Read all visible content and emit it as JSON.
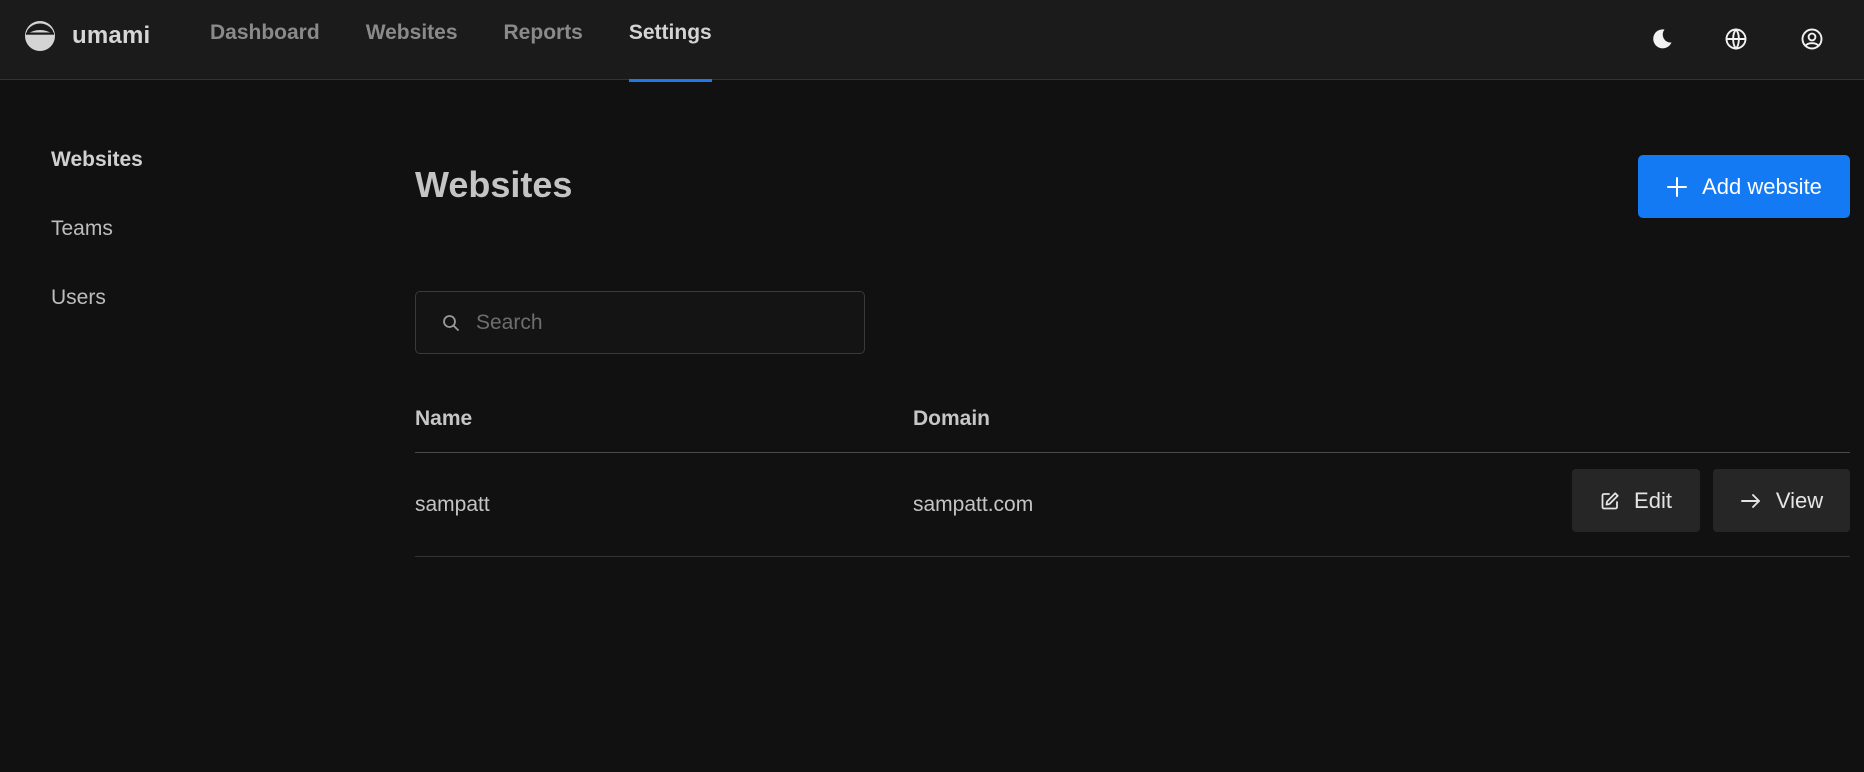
{
  "app": {
    "name": "umami"
  },
  "header": {
    "nav": [
      {
        "label": "Dashboard",
        "active": false
      },
      {
        "label": "Websites",
        "active": false
      },
      {
        "label": "Reports",
        "active": false
      },
      {
        "label": "Settings",
        "active": true
      }
    ],
    "icons": [
      "moon-icon",
      "globe-icon",
      "user-icon"
    ]
  },
  "sidebar": {
    "items": [
      {
        "label": "Websites",
        "active": true
      },
      {
        "label": "Teams",
        "active": false
      },
      {
        "label": "Users",
        "active": false
      }
    ]
  },
  "main": {
    "title": "Websites",
    "add_button": {
      "label": "Add website",
      "icon": "plus-icon"
    },
    "search": {
      "placeholder": "Search",
      "value": ""
    },
    "table": {
      "columns": [
        "Name",
        "Domain"
      ],
      "rows": [
        {
          "name": "sampatt",
          "domain": "sampatt.com",
          "edit_label": "Edit",
          "view_label": "View"
        }
      ]
    }
  },
  "colors": {
    "background": "#111111",
    "header_bg": "#1b1b1b",
    "accent": "#147af3",
    "button_bg": "#262626"
  }
}
